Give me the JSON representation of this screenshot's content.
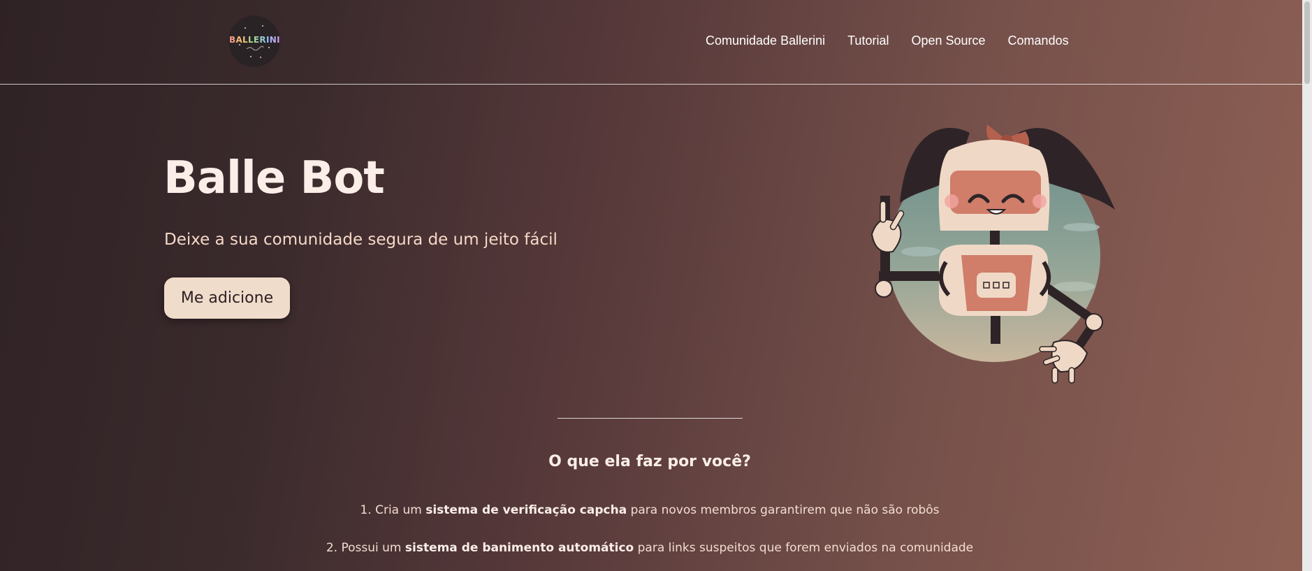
{
  "navbar": {
    "logo_text": "BALLERINI",
    "links": [
      "Comunidade Ballerini",
      "Tutorial",
      "Open Source",
      "Comandos"
    ]
  },
  "hero": {
    "title": "Balle Bot",
    "subtitle": "Deixe a sua comunidade segura de um jeito fácil",
    "cta_label": "Me adicione"
  },
  "features": {
    "title": "O que ela faz por você?",
    "items": [
      {
        "prefix": "1. Cria um ",
        "highlight": "sistema de verificação capcha",
        "suffix": " para novos membros garantirem que não são robôs"
      },
      {
        "prefix": "2. Possui um ",
        "highlight": "sistema de banimento automático",
        "suffix": " para links suspeitos que forem enviados na comunidade"
      }
    ]
  },
  "colors": {
    "background_start": "#2f2225",
    "background_end": "#8f6155",
    "button_bg": "#f0dccb",
    "text_light": "#fbeee8"
  },
  "icons": [
    "ballerini-logo",
    "robot-mascot"
  ]
}
